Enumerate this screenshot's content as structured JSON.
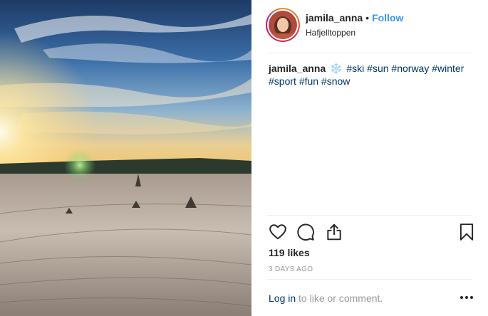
{
  "post": {
    "username": "jamila_anna",
    "separator": "•",
    "follow_label": "Follow",
    "location": "Hafjelltoppen"
  },
  "caption": {
    "username": "jamila_anna",
    "emoji": "❄️",
    "hashtags": [
      "#ski",
      "#sun",
      "#norway",
      "#winter",
      "#sport",
      "#fun",
      "#snow"
    ]
  },
  "engagement": {
    "likes_text": "119 likes",
    "time_text": "3 DAYS AGO"
  },
  "footer": {
    "login_label": "Log in",
    "login_suffix": "to like or comment."
  },
  "icons": {
    "like": "heart-icon",
    "comment": "comment-icon",
    "share": "share-icon",
    "save": "bookmark-icon",
    "more": "more-options-icon"
  },
  "colors": {
    "follow": "#3897f0",
    "link": "#003569",
    "muted": "#999999",
    "text": "#262626"
  }
}
